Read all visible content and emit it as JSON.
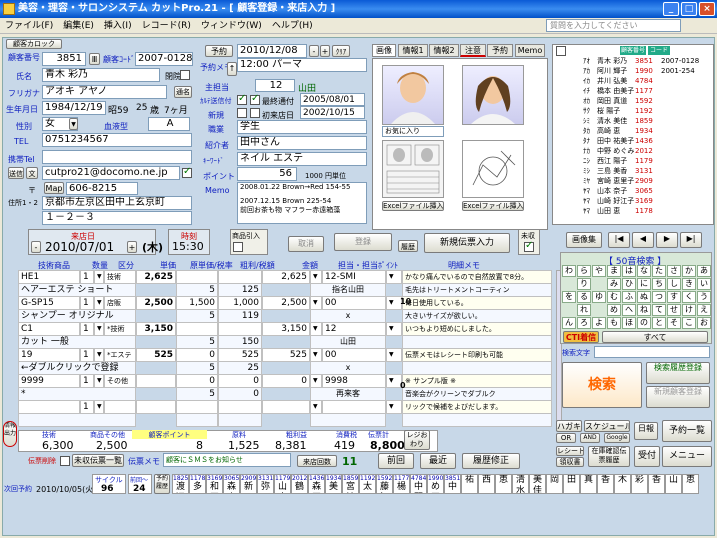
{
  "title": "美容・理容・サロンシステム カットPro.21 - [ 顧客登録・来店入力 ]",
  "menu": [
    "ファイル(F)",
    "編集(E)",
    "挿入(I)",
    "レコード(R)",
    "ウィンドウ(W)",
    "ヘルプ(H)"
  ],
  "help_placeholder": "質問を入力してください",
  "customer": {
    "camera_label": "顧客カロック",
    "no_label": "顧客番号",
    "no": "3851",
    "code_label": "顧客ｺｰﾄﾞ",
    "code": "2007-0128",
    "name_label": "氏名",
    "name": "青木 彩乃",
    "closed_label": "閉院",
    "kana_label": "フリガナ",
    "kana": "アオキ アヤノ",
    "tsuka": "通名",
    "birth_label": "生年月日",
    "birth": "1984/12/19",
    "era": "昭59",
    "age": "25",
    "age_unit": "歳",
    "months": "7ヶ月",
    "gender_label": "性別",
    "gender": "女",
    "blood_label": "血液型",
    "blood": "A",
    "tel_label": "TEL",
    "tel": "0751234567",
    "mobile_label": "携帯Tel",
    "mail_btn": "送信",
    "mail_btn2": "文",
    "email": "cutpro21@docomo.ne.jp",
    "map_btn": "Map",
    "zip_label": "〒",
    "zip": "606-8215",
    "addr_label": "住所1・2",
    "addr1": "京都市左京区田中上玄京町",
    "addr2": "１－２－３"
  },
  "info": {
    "staff_label": "主担当",
    "staff_no": "12",
    "staff": "山田",
    "card_label": "ｶﾙﾃ送信付",
    "dm_label": "最終通付",
    "dm_date": "2005/08/01",
    "new_label": "新規",
    "first_label": "初来店日",
    "first_date": "2002/10/15",
    "job_label": "職業",
    "job": "学生",
    "intro_label": "紹介者",
    "intro": "田中さん",
    "key_label": "ｷｰﾜｰﾄﾞ",
    "key": "ネイル エステ",
    "point_label": "ポイント",
    "point": "56",
    "point_unit": "1000 円単位",
    "memo_label": "Memo",
    "memo1": "2008.01.22  Brown→Red 154-55",
    "memo2": "2007.12.15  Brown  225-54",
    "memo3": "前回お茶も物  マフラー赤遠箱藻"
  },
  "reserve": {
    "label": "予約",
    "date": "2010/12/08",
    "clear": "ｸﾘｱ",
    "memo_label": "予約メモ",
    "time": "12:00",
    "menu": "パーマ"
  },
  "photo_tabs": [
    "画像",
    "情報1",
    "情報2",
    "注意",
    "予約",
    "Memo"
  ],
  "photo": {
    "fav": "お気に入り",
    "excel1": "Excelファイル挿入",
    "excel2": "Excelファイル挿入"
  },
  "visit": {
    "date_label": "来店日",
    "date": "2010/07/01",
    "dow": "(木)",
    "time_label": "時刻",
    "time": "15:30",
    "product_label": "商品引入",
    "cancel": "取消",
    "register": "登録",
    "history": "履歴",
    "new_slip": "新規伝票入力",
    "unpaid": "未収"
  },
  "grid_headers": [
    "技術商品",
    "数量",
    "区分",
    "単価",
    "原単価/税率",
    "粗利/税額",
    "金額",
    "担当・担当ﾎﾟｲﾝﾄ",
    "明細メモ"
  ],
  "rows": [
    {
      "item": "HE1",
      "qty": "1",
      "kind": "技術",
      "price": "2,625",
      "cost": "",
      "gross": "",
      "amt": "2,625",
      "staff": "12-SMI",
      "memo": "かなり痛んでいるので自然放置で8分。",
      "sub": "ヘアーエステ ショート",
      "c2": "5",
      "g2": "125",
      "s2": "指名山田",
      "m2": "毛先はトリートメントコーティン"
    },
    {
      "item": "G-SP15",
      "qty": "1",
      "kind": "店販",
      "price": "2,500",
      "cost": "1,500",
      "gross": "1,000",
      "amt": "2,500",
      "staff": "00",
      "pt": "10",
      "memo": "毎日使用している。",
      "sub": "シャンプー オリジナル",
      "c2": "5",
      "g2": "119",
      "s2": "x",
      "m2": "大きいサイズが欲しい。"
    },
    {
      "item": "C1",
      "qty": "1",
      "kind": "*技術",
      "price": "3,150",
      "cost": "",
      "gross": "",
      "amt": "3,150",
      "staff": "12",
      "memo": "いつもより短めにしました。",
      "sub": "カット 一般",
      "c2": "5",
      "g2": "150",
      "s2": "山田",
      "m2": ""
    },
    {
      "item": "19",
      "qty": "1",
      "kind": "*エステ",
      "price": "525",
      "cost": "0",
      "gross": "525",
      "amt": "525",
      "staff": "00",
      "memo": "伝票メモはレシート印刷も可能",
      "sub": "←ダブルクリックで登録",
      "c2": "5",
      "g2": "25",
      "s2": "x",
      "m2": ""
    },
    {
      "item": "9999",
      "qty": "1",
      "kind": "その他",
      "price": "",
      "cost": "0",
      "gross": "0",
      "amt": "0",
      "staff": "9998",
      "pt": "0",
      "memo": "※ サンプル版 ※",
      "sub": "*",
      "c2": "5",
      "g2": "0",
      "s2": "再来客",
      "m2": "音楽会がクリーンでダブルク"
    },
    {
      "item": "",
      "qty": "1",
      "kind": "",
      "price": "",
      "cost": "",
      "gross": "",
      "amt": "",
      "staff": "",
      "memo": "リックで候補をよびだします。",
      "sub": "",
      "c2": "",
      "g2": "",
      "s2": "",
      "m2": ""
    }
  ],
  "totals": {
    "tech_label": "技術",
    "tech": "6,300",
    "prod_label": "商品その他",
    "prod": "2,500",
    "point_label": "顧客ポイント",
    "point": "8",
    "cost_label": "原料",
    "cost": "1,525",
    "gross_label": "粗利益",
    "gross": "8,381",
    "tax_label": "消費税",
    "tax": "419",
    "total_label": "伝票計",
    "total": "8,800",
    "receipt": "レジおわり"
  },
  "footer": {
    "delete": "伝票削除",
    "unentered": "未収伝票一覧",
    "slip_memo_label": "伝票メモ",
    "slip_memo": "顧客にＳＭＳをお知らせ",
    "visit_count_label": "来店回数",
    "visit_count": "11",
    "prev": "前回",
    "latest": "最近",
    "history_fix": "履歴修正",
    "next_label": "次回予約",
    "next_date": "2010/10/05(火)",
    "cycle_label": "サイクル",
    "cycle": "96",
    "interval_label": "前回〜",
    "interval": "24",
    "rsv_hist": "予約履歴",
    "print": "情報出力"
  },
  "right": {
    "image_list": "画像集",
    "kana_title": "【 50音検索 】",
    "kana": [
      "わ",
      "ら",
      "や",
      "ま",
      "は",
      "な",
      "た",
      "さ",
      "か",
      "あ",
      "",
      "り",
      "",
      "み",
      "ひ",
      "に",
      "ち",
      "し",
      "き",
      "い",
      "を",
      "る",
      "ゆ",
      "む",
      "ふ",
      "ぬ",
      "つ",
      "す",
      "く",
      "う",
      "",
      "れ",
      "",
      "め",
      "へ",
      "ね",
      "て",
      "せ",
      "け",
      "え",
      "ん",
      "ろ",
      "よ",
      "も",
      "ほ",
      "の",
      "と",
      "そ",
      "こ",
      "お"
    ],
    "cti": "CTI着信",
    "all": "すべて",
    "search_label": "検索文字",
    "search": "検索",
    "cond_search": "検索履歴登録",
    "new_reg": "新規顧客登録",
    "b1": "ハガキ",
    "b2": "スケジュール",
    "b3": "日報",
    "b4": "予約一覧",
    "b5": "OR",
    "b6": "AND",
    "b7": "Google",
    "b8": "レシート",
    "b9": "領収書",
    "b10": "在庫確認伝票履歴",
    "b11": "受付",
    "b12": "メニュー"
  },
  "list_header": [
    "顧客番号",
    "コード"
  ],
  "customers": [
    [
      "ｱｵ",
      "青木 彩乃",
      "3851",
      "2007-0128"
    ],
    [
      "ｱｶ",
      "阿川 輝子",
      "1990",
      "2001-254"
    ],
    [
      "ｲｶ",
      "井川 弘美",
      "4784",
      ""
    ],
    [
      "ｲﾁ",
      "橋本 由美子",
      "1177",
      ""
    ],
    [
      "ｵｶ",
      "岡田 真道",
      "1592",
      ""
    ],
    [
      "ｻｸ",
      "桜 陽子",
      "1192",
      ""
    ],
    [
      "ｼﾐ",
      "清水 美佳",
      "1859",
      ""
    ],
    [
      "ﾀｶ",
      "高崎 恵",
      "1934",
      ""
    ],
    [
      "ﾀﾅ",
      "田中 祐美子",
      "1436",
      ""
    ],
    [
      "ﾅｶ",
      "中野 めぐみ",
      "2012",
      ""
    ],
    [
      "ﾆｼ",
      "西江 陽子",
      "1179",
      ""
    ],
    [
      "ﾐｼ",
      "三島 美香",
      "3131",
      ""
    ],
    [
      "ﾐﾔ",
      "宮崎 恵里子",
      "2909",
      ""
    ],
    [
      "ﾔﾏ",
      "山本 奈子",
      "3065",
      ""
    ],
    [
      "ﾔﾏ",
      "山崎 好江子",
      "3169",
      ""
    ],
    [
      "ﾔﾏ",
      "山田 恵",
      "1178",
      ""
    ]
  ],
  "bottom_list": [
    [
      "1825",
      "渡辺"
    ],
    [
      "1178",
      "多"
    ],
    [
      "3169",
      "和田"
    ],
    [
      "3065",
      "森山"
    ],
    [
      "2909",
      "新"
    ],
    [
      "3131",
      "弥"
    ],
    [
      "1179",
      "山本"
    ],
    [
      "2012",
      "鶴"
    ],
    [
      "1436",
      "森田"
    ],
    [
      "1934",
      "美"
    ],
    [
      "1859",
      "宮地"
    ],
    [
      "1192",
      "太"
    ],
    [
      "1592",
      "藤江"
    ],
    [
      "1177",
      "楊"
    ],
    [
      "4784",
      "中野"
    ],
    [
      "1990",
      "め田"
    ],
    [
      "3851",
      "中"
    ],
    [
      "",
      "祐"
    ],
    [
      "",
      "西"
    ],
    [
      "",
      "恵"
    ],
    [
      "",
      "清水"
    ],
    [
      "",
      "美佳"
    ],
    [
      "",
      "岡"
    ],
    [
      "",
      "田"
    ],
    [
      "",
      "真"
    ],
    [
      "",
      "香"
    ],
    [
      "",
      "木"
    ],
    [
      "",
      "彩"
    ],
    [
      "",
      "香"
    ],
    [
      "",
      "山"
    ],
    [
      "",
      "恵"
    ]
  ]
}
